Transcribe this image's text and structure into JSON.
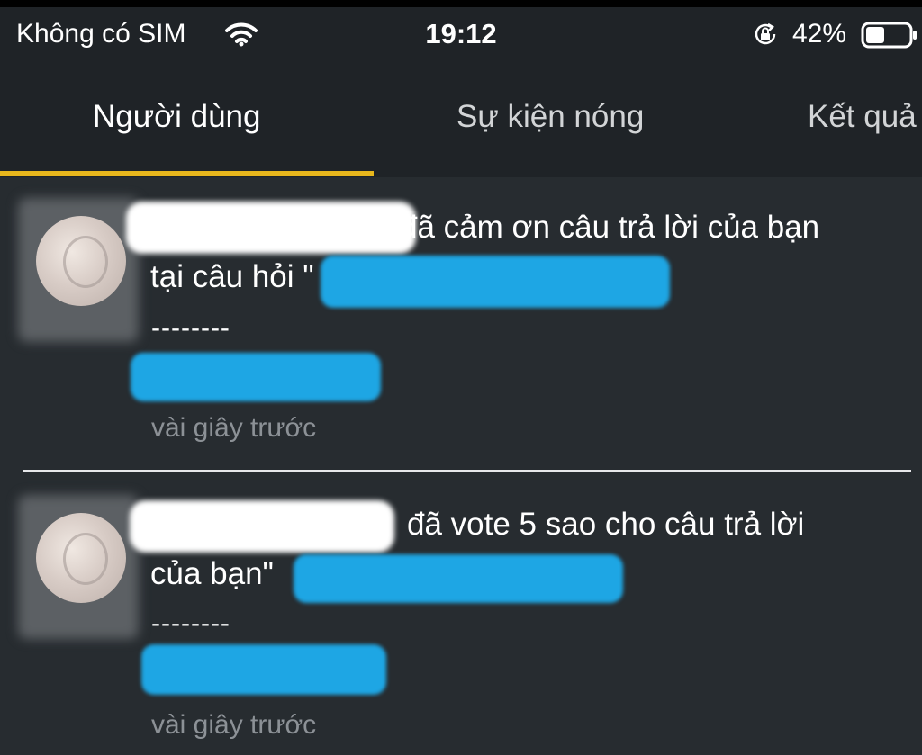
{
  "status_bar": {
    "carrier": "Không có SIM",
    "time": "19:12",
    "battery": "42%",
    "icons": [
      "wifi-icon",
      "rotation-lock-icon",
      "battery-icon"
    ]
  },
  "tabs": [
    {
      "label": "Người dùng",
      "active": true
    },
    {
      "label": "Sự kiện nóng",
      "active": false
    },
    {
      "label": "Kết quả",
      "active": false
    }
  ],
  "accent_color": "#e8b71c",
  "redaction_color": "#1ea6e4",
  "notifications": [
    {
      "line1": "đã cảm ơn câu trả lời của bạn",
      "line2": "tại câu hỏi \"",
      "separator": "--------",
      "time": "vài giây trước"
    },
    {
      "line1": "đã vote 5 sao cho câu trả lời",
      "line2": "của bạn\"",
      "separator": "--------",
      "time": "vài giây trước"
    }
  ]
}
